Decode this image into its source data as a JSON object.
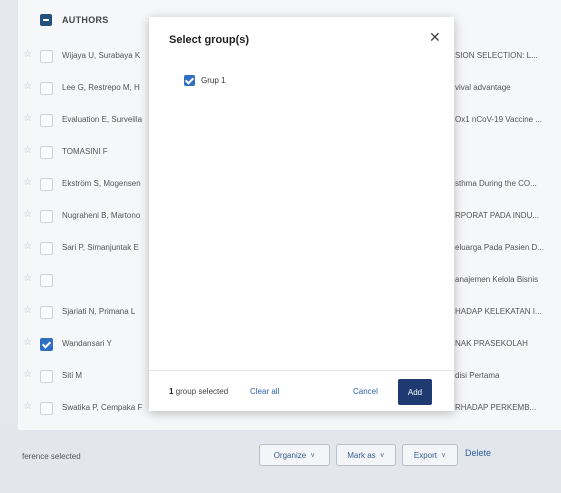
{
  "table": {
    "header": {
      "authors_label": "AUTHORS"
    },
    "rows": [
      {
        "author": "Wijaya U, Surabaya K",
        "title": "SION SELECTION: L...",
        "checked": false
      },
      {
        "author": "Lee G, Restrepo M, H",
        "title": "vival advantage",
        "checked": false
      },
      {
        "author": "Evaluation E, Surveilla",
        "title": "Ox1 nCoV-19 Vaccine ...",
        "checked": false
      },
      {
        "author": "TOMASINI F",
        "title": "",
        "checked": false
      },
      {
        "author": "Ekström S, Mogensen",
        "title": "sthma During the CO...",
        "checked": false
      },
      {
        "author": "Nugraheni B, Martono",
        "title": "RPORAT PADA INDU...",
        "checked": false
      },
      {
        "author": "Sari P, Simanjuntak E",
        "title": "eluarga Pada Pasien D...",
        "checked": false
      },
      {
        "author": "",
        "title": "anajemen Kelola Bisnis",
        "checked": false
      },
      {
        "author": "Sjariati N, Primana L",
        "title": "HADAP KELEKATAN I...",
        "checked": false
      },
      {
        "author": "Wandansari Y",
        "title": "NAK PRASEKOLAH",
        "checked": true
      },
      {
        "author": "Siti M",
        "title": "disi Pertama",
        "checked": false
      },
      {
        "author": "Swatika P, Cempaka F",
        "title": "RHADAP PERKEMB...",
        "checked": false
      }
    ]
  },
  "bottombar": {
    "selected_text": "ference selected",
    "organize_label": "Organize",
    "markas_label": "Mark as",
    "export_label": "Export",
    "delete_label": "Delete"
  },
  "modal": {
    "title": "Select group(s)",
    "close_glyph": "✕",
    "groups": [
      {
        "label": "Grup 1",
        "checked": true
      }
    ],
    "footer": {
      "count_number": "1",
      "count_suffix": " group selected",
      "clear_all_label": "Clear all",
      "cancel_label": "Cancel",
      "add_label": "Add"
    }
  },
  "icons": {
    "star": "☆",
    "chevron": "∨"
  },
  "colors": {
    "accent": "#2e6fc4",
    "primary_button": "#1f3a70",
    "link": "#2f62a8"
  }
}
